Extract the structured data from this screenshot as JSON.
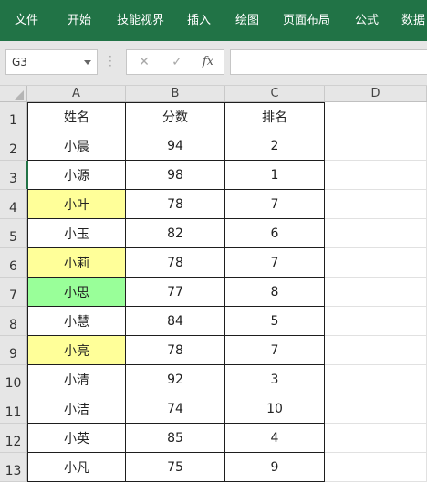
{
  "ribbon": {
    "tabs": [
      "文件",
      "开始",
      "技能视界",
      "插入",
      "绘图",
      "页面布局",
      "公式",
      "数据"
    ]
  },
  "formula_bar": {
    "name_box": "G3",
    "cancel_glyph": "✕",
    "confirm_glyph": "✓",
    "fx_label": "fx",
    "formula_value": ""
  },
  "sheet": {
    "columns": [
      "A",
      "B",
      "C",
      "D"
    ],
    "rows": [
      "1",
      "2",
      "3",
      "4",
      "5",
      "6",
      "7",
      "8",
      "9",
      "10",
      "11",
      "12",
      "13"
    ],
    "header": [
      "姓名",
      "分数",
      "排名"
    ],
    "data": [
      [
        "小晨",
        "94",
        "2"
      ],
      [
        "小源",
        "98",
        "1"
      ],
      [
        "小叶",
        "78",
        "7"
      ],
      [
        "小玉",
        "82",
        "6"
      ],
      [
        "小莉",
        "78",
        "7"
      ],
      [
        "小思",
        "77",
        "8"
      ],
      [
        "小慧",
        "84",
        "5"
      ],
      [
        "小亮",
        "78",
        "7"
      ],
      [
        "小清",
        "92",
        "3"
      ],
      [
        "小洁",
        "74",
        "10"
      ],
      [
        "小英",
        "85",
        "4"
      ],
      [
        "小凡",
        "75",
        "9"
      ]
    ],
    "highlight_colors": {
      "yellow": "#ffff99",
      "green": "#99ff99"
    },
    "highlights": {
      "小叶": "yellow",
      "小莉": "yellow",
      "小思": "green",
      "小亮": "yellow"
    }
  },
  "colors": {
    "ribbon_bg": "#217346",
    "header_bg": "#e6e6e6"
  }
}
